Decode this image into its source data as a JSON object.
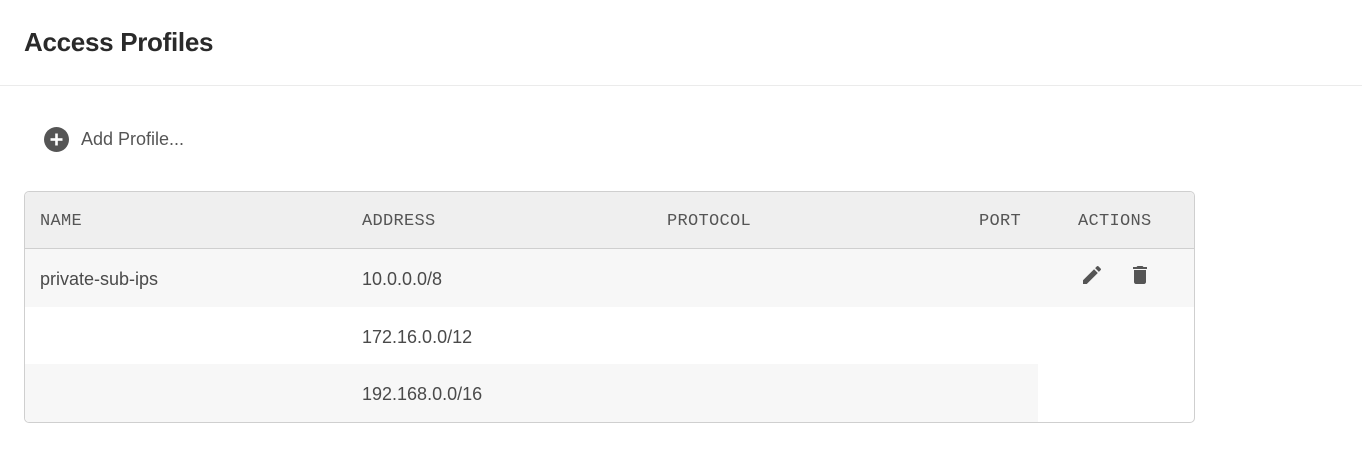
{
  "header": {
    "title": "Access Profiles"
  },
  "toolbar": {
    "add_label": "Add Profile...",
    "add_icon": "plus-circle-icon"
  },
  "table": {
    "columns": [
      "NAME",
      "ADDRESS",
      "PROTOCOL",
      "PORT",
      "ACTIONS"
    ],
    "profiles": [
      {
        "name": "private-sub-ips",
        "addresses": [
          "10.0.0.0/8",
          "172.16.0.0/12",
          "192.168.0.0/16"
        ],
        "protocol": "",
        "port": "",
        "actions": [
          "edit-icon",
          "delete-icon"
        ]
      }
    ]
  },
  "colors": {
    "header_bg": "#efefef",
    "row_shade": "#f7f7f7",
    "border": "#cfcfcf",
    "icon": "#555555"
  }
}
